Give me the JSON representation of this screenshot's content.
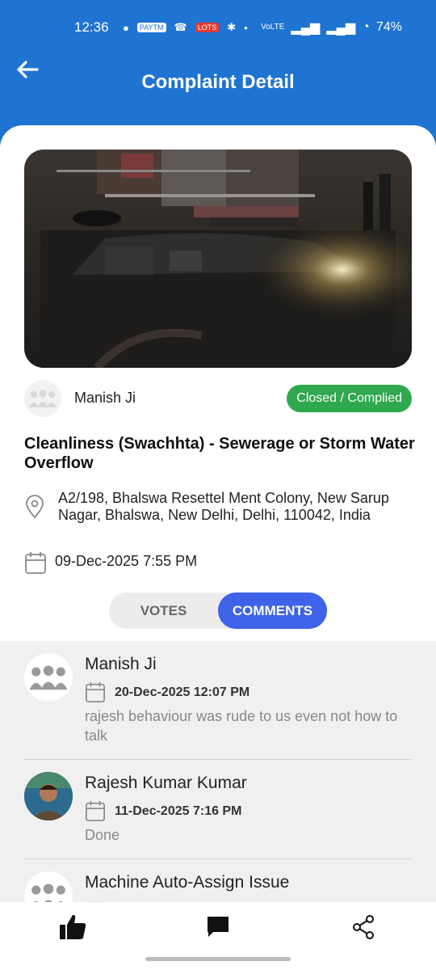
{
  "status_bar": {
    "time": "12:36",
    "battery": "74%",
    "notifications": [
      "PAYTM",
      "LOTS"
    ]
  },
  "header": {
    "title": "Complaint Detail"
  },
  "complaint": {
    "owner_name": "Manish Ji",
    "status": "Closed / Complied",
    "title": "Cleanliness (Swachhta) - Sewerage or Storm Water Overflow",
    "address": "A2/198, Bhalswa Resettel Ment Colony, New Sarup Nagar, Bhalswa, New Delhi, Delhi, 110042, India",
    "datetime": "09-Dec-2025 7:55 PM"
  },
  "tabs": {
    "votes": "VOTES",
    "comments": "COMMENTS",
    "active": "comments"
  },
  "comments": [
    {
      "name": "Manish Ji",
      "date": "20-Dec-2025 12:07 PM",
      "text": "rajesh behaviour was rude to us even not how to talk",
      "avatar": "group-avatar-icon"
    },
    {
      "name": "Rajesh Kumar Kumar",
      "date": "11-Dec-2025 7:16 PM",
      "text": "Done",
      "avatar": "user-photo"
    },
    {
      "name": "Machine Auto-Assign Issue",
      "date": "",
      "text": "",
      "avatar": "group-avatar-icon"
    }
  ],
  "bottom_nav": [
    "thumbs-up-icon",
    "comment-icon",
    "share-icon"
  ],
  "colors": {
    "primary": "#1e74d0",
    "status_badge": "#2fa84f",
    "active_tab": "#3f63e8"
  }
}
